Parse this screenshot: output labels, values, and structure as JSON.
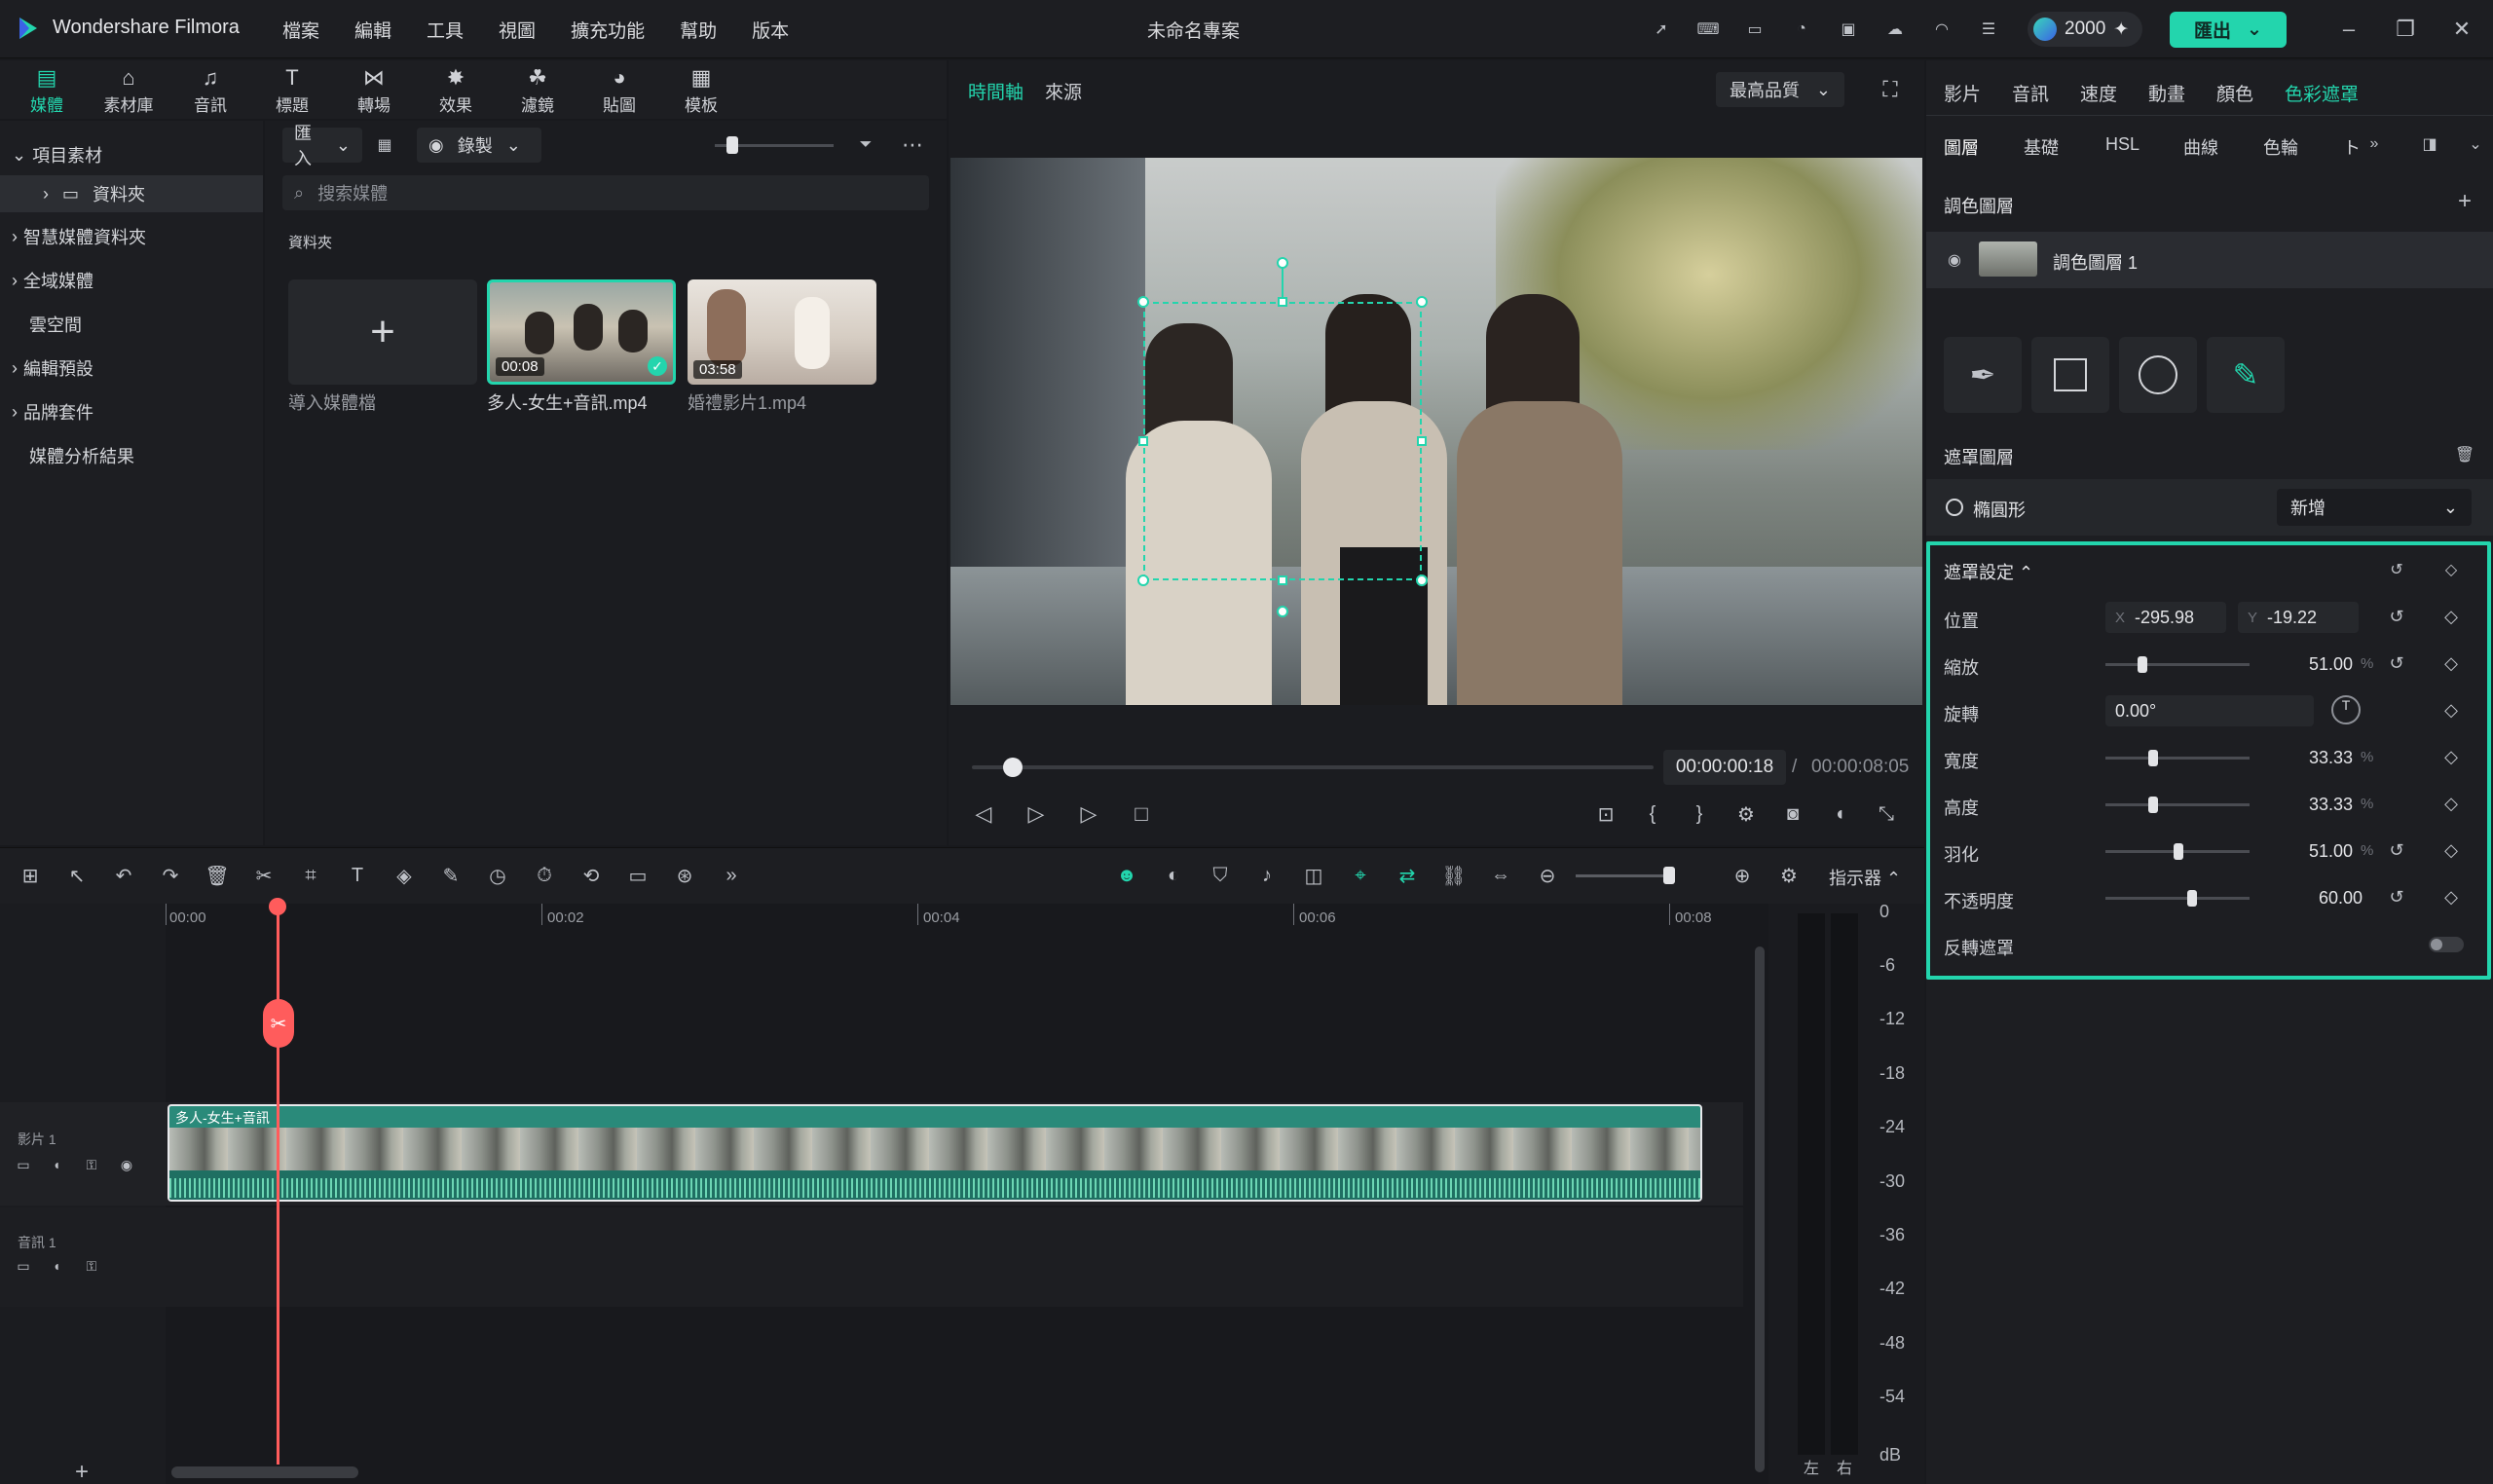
{
  "app": {
    "name": "Wondershare Filmora",
    "project_title": "未命名專案",
    "credits": "2000",
    "export_label": "匯出"
  },
  "menu": [
    "檔案",
    "編輯",
    "工具",
    "視圖",
    "擴充功能",
    "幫助",
    "版本"
  ],
  "media_tabs": [
    "媒體",
    "素材庫",
    "音訊",
    "標題",
    "轉場",
    "效果",
    "濾鏡",
    "貼圖",
    "模板"
  ],
  "sidebar": {
    "items": [
      "項目素材",
      "資料夾",
      "智慧媒體資料夾",
      "全域媒體",
      "雲空間",
      "編輯預設",
      "品牌套件",
      "媒體分析結果"
    ]
  },
  "media": {
    "import_label": "匯入",
    "record_label": "錄製",
    "search_placeholder": "搜索媒體",
    "folder_label": "資料夾",
    "import_tile_label": "導入媒體檔",
    "items": [
      {
        "name": "多人-女生+音訊.mp4",
        "duration": "00:08"
      },
      {
        "name": "婚禮影片1.mp4",
        "duration": "03:58"
      }
    ]
  },
  "player": {
    "tabs": [
      "時間軸",
      "來源"
    ],
    "quality": "最高品質",
    "current_time": "00:00:00:18",
    "separator": "/",
    "total_time": "00:00:08:05",
    "progress": 0.06
  },
  "right": {
    "tabs": [
      "影片",
      "音訊",
      "速度",
      "動畫",
      "顏色",
      "色彩遮罩"
    ],
    "subtabs": [
      "圖層",
      "基礎",
      "HSL",
      "曲線",
      "色輪",
      "ト"
    ],
    "color_layers_title": "調色圖層",
    "layer_name": "調色圖層 1",
    "mask_layer_title": "遮罩圖層",
    "shape_name": "橢圓形",
    "shape_select": "新增",
    "mask_settings_title": "遮罩設定",
    "params": {
      "position_label": "位置",
      "pos_x_label": "X",
      "pos_x": "-295.98",
      "pos_y_label": "Y",
      "pos_y": "-19.22",
      "scale_label": "縮放",
      "scale": "51.00",
      "scale_unit": "%",
      "scale_level": 0.26,
      "rotate_label": "旋轉",
      "rotate": "0.00°",
      "width_label": "寬度",
      "width": "33.33",
      "width_unit": "%",
      "width_level": 0.33,
      "height_label": "高度",
      "height": "33.33",
      "height_unit": "%",
      "height_level": 0.33,
      "feather_label": "羽化",
      "feather": "51.00",
      "feather_unit": "%",
      "feather_level": 0.51,
      "opacity_label": "不透明度",
      "opacity": "60.00",
      "opacity_level": 0.6,
      "invert_label": "反轉遮罩"
    }
  },
  "timeline": {
    "indicator_label": "指示器",
    "ruler": [
      "00:00",
      "00:02",
      "00:04",
      "00:06",
      "00:08"
    ],
    "clip_title": "多人-女生+音訊",
    "video_track": "影片 1",
    "audio_track": "音訊 1",
    "meter_ticks": [
      "0",
      "-6",
      "-12",
      "-18",
      "-24",
      "-30",
      "-36",
      "-42",
      "-48",
      "-54",
      "dB"
    ],
    "meter_left": "左",
    "meter_right": "右"
  },
  "colors": {
    "accent": "#23d5ad",
    "playhead": "#ff5c5c"
  }
}
